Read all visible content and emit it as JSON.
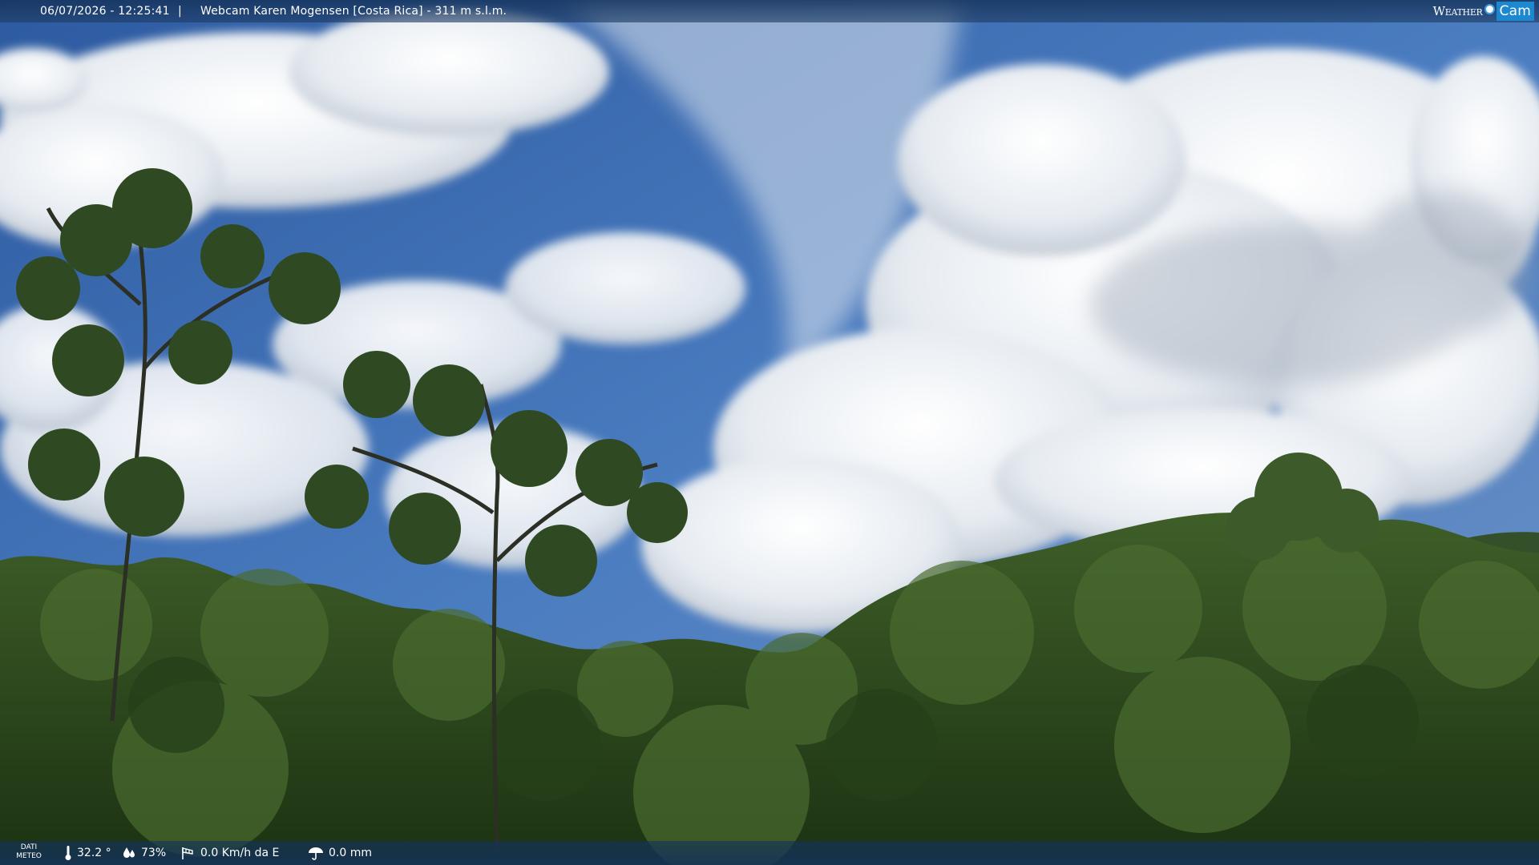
{
  "overlay": {
    "datetime": "06/07/2026 - 12:25:41",
    "separator": "|",
    "caption": "Webcam Karen Mogensen [Costa Rica] - 311 m s.l.m."
  },
  "brand": {
    "word1": "Weather",
    "word2": "Cam"
  },
  "weather": {
    "label_line1": "DATI",
    "label_line2": "METEO",
    "temperature": "32.2 °",
    "humidity": "73%",
    "wind": "0.0 Km/h da E",
    "rain": "0.0 mm"
  },
  "colors": {
    "sky": "#3f6fb4",
    "cloud": "#f1f4f7",
    "forest": "#2e4d1f",
    "bar": "#1e3c66",
    "brand_accent": "#1d88d0"
  }
}
